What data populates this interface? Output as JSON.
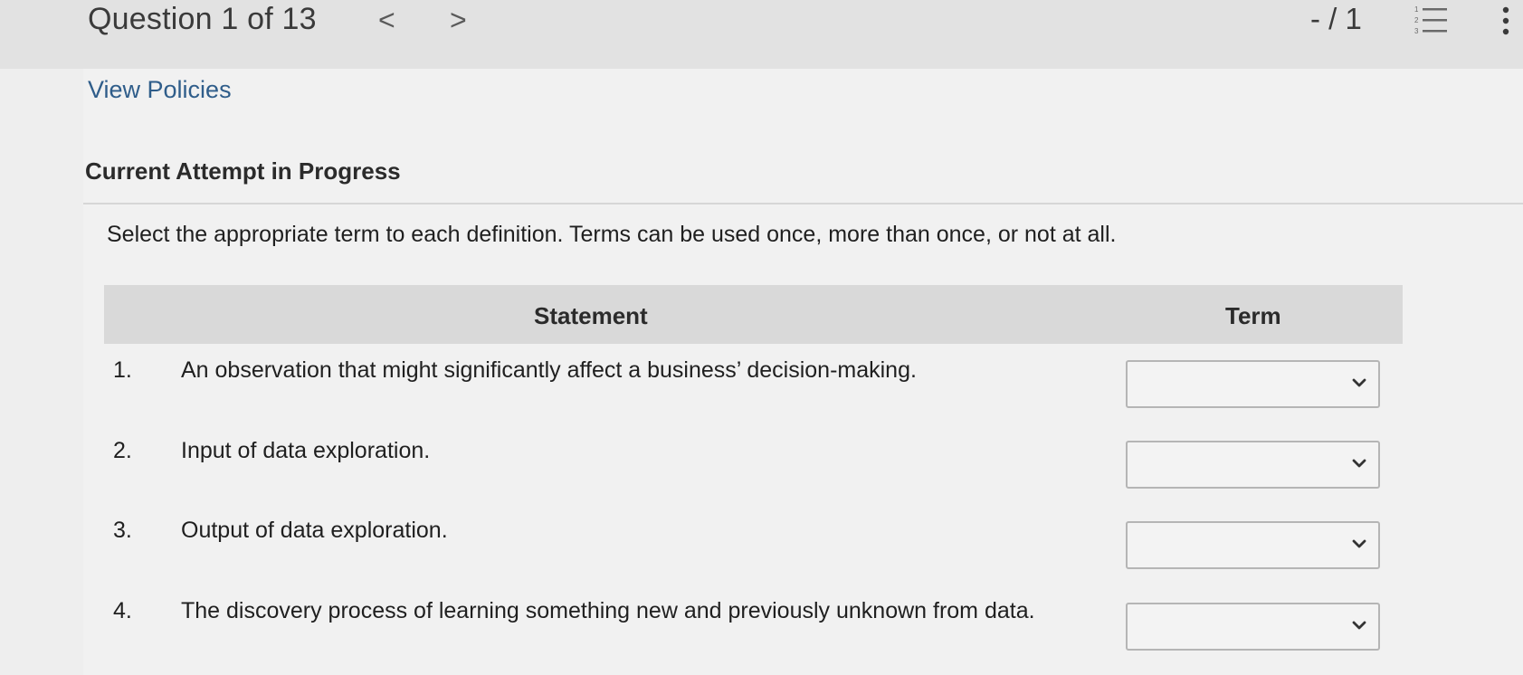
{
  "header": {
    "question_label": "Question 1 of 13",
    "prev_glyph": "<",
    "next_glyph": ">",
    "score": "- / 1",
    "list_icon": "numbered-list-icon",
    "more_icon": "vertical-dots-icon"
  },
  "links": {
    "view_policies": "View Policies"
  },
  "attempt_heading": "Current Attempt in Progress",
  "instructions": "Select the appropriate term to each definition. Terms can be used once, more than once, or not at all.",
  "table": {
    "headers": {
      "statement": "Statement",
      "term": "Term"
    },
    "rows": [
      {
        "num": "1.",
        "statement": "An observation that might significantly affect a business’ decision-making.",
        "selected": ""
      },
      {
        "num": "2.",
        "statement": "Input of data exploration.",
        "selected": ""
      },
      {
        "num": "3.",
        "statement": "Output of data exploration.",
        "selected": ""
      },
      {
        "num": "4.",
        "statement": "The discovery process of learning something new and previously unknown from data.",
        "selected": ""
      }
    ]
  },
  "colors": {
    "link": "#2f5d8a",
    "header_bg": "#d9d9d9",
    "page_bg": "#eeeeee"
  }
}
